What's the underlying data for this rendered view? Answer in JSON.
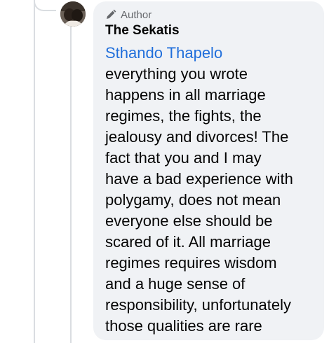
{
  "comment": {
    "badge_label": "Author",
    "badge_icon": "pencil-icon",
    "author_name": "The Sekatis",
    "mention": "Sthando Thapelo",
    "body_lines": [
      "everything you wrote",
      "happens in all marriage",
      "regimes, the fights, the",
      "jealousy and divorces! The",
      "fact that you and I may",
      "have a bad experience with",
      "polygamy, does not mean",
      "everyone else should be",
      "scared of it. All marriage",
      "regimes requires wisdom",
      "and a huge sense of",
      "responsibility, unfortunately",
      "those qualities are rare"
    ]
  },
  "colors": {
    "bubble_bg": "#f0f2f5",
    "mention": "#216fdb",
    "badge_text": "#65676b",
    "text": "#050505",
    "thread_line": "#dadde1"
  }
}
